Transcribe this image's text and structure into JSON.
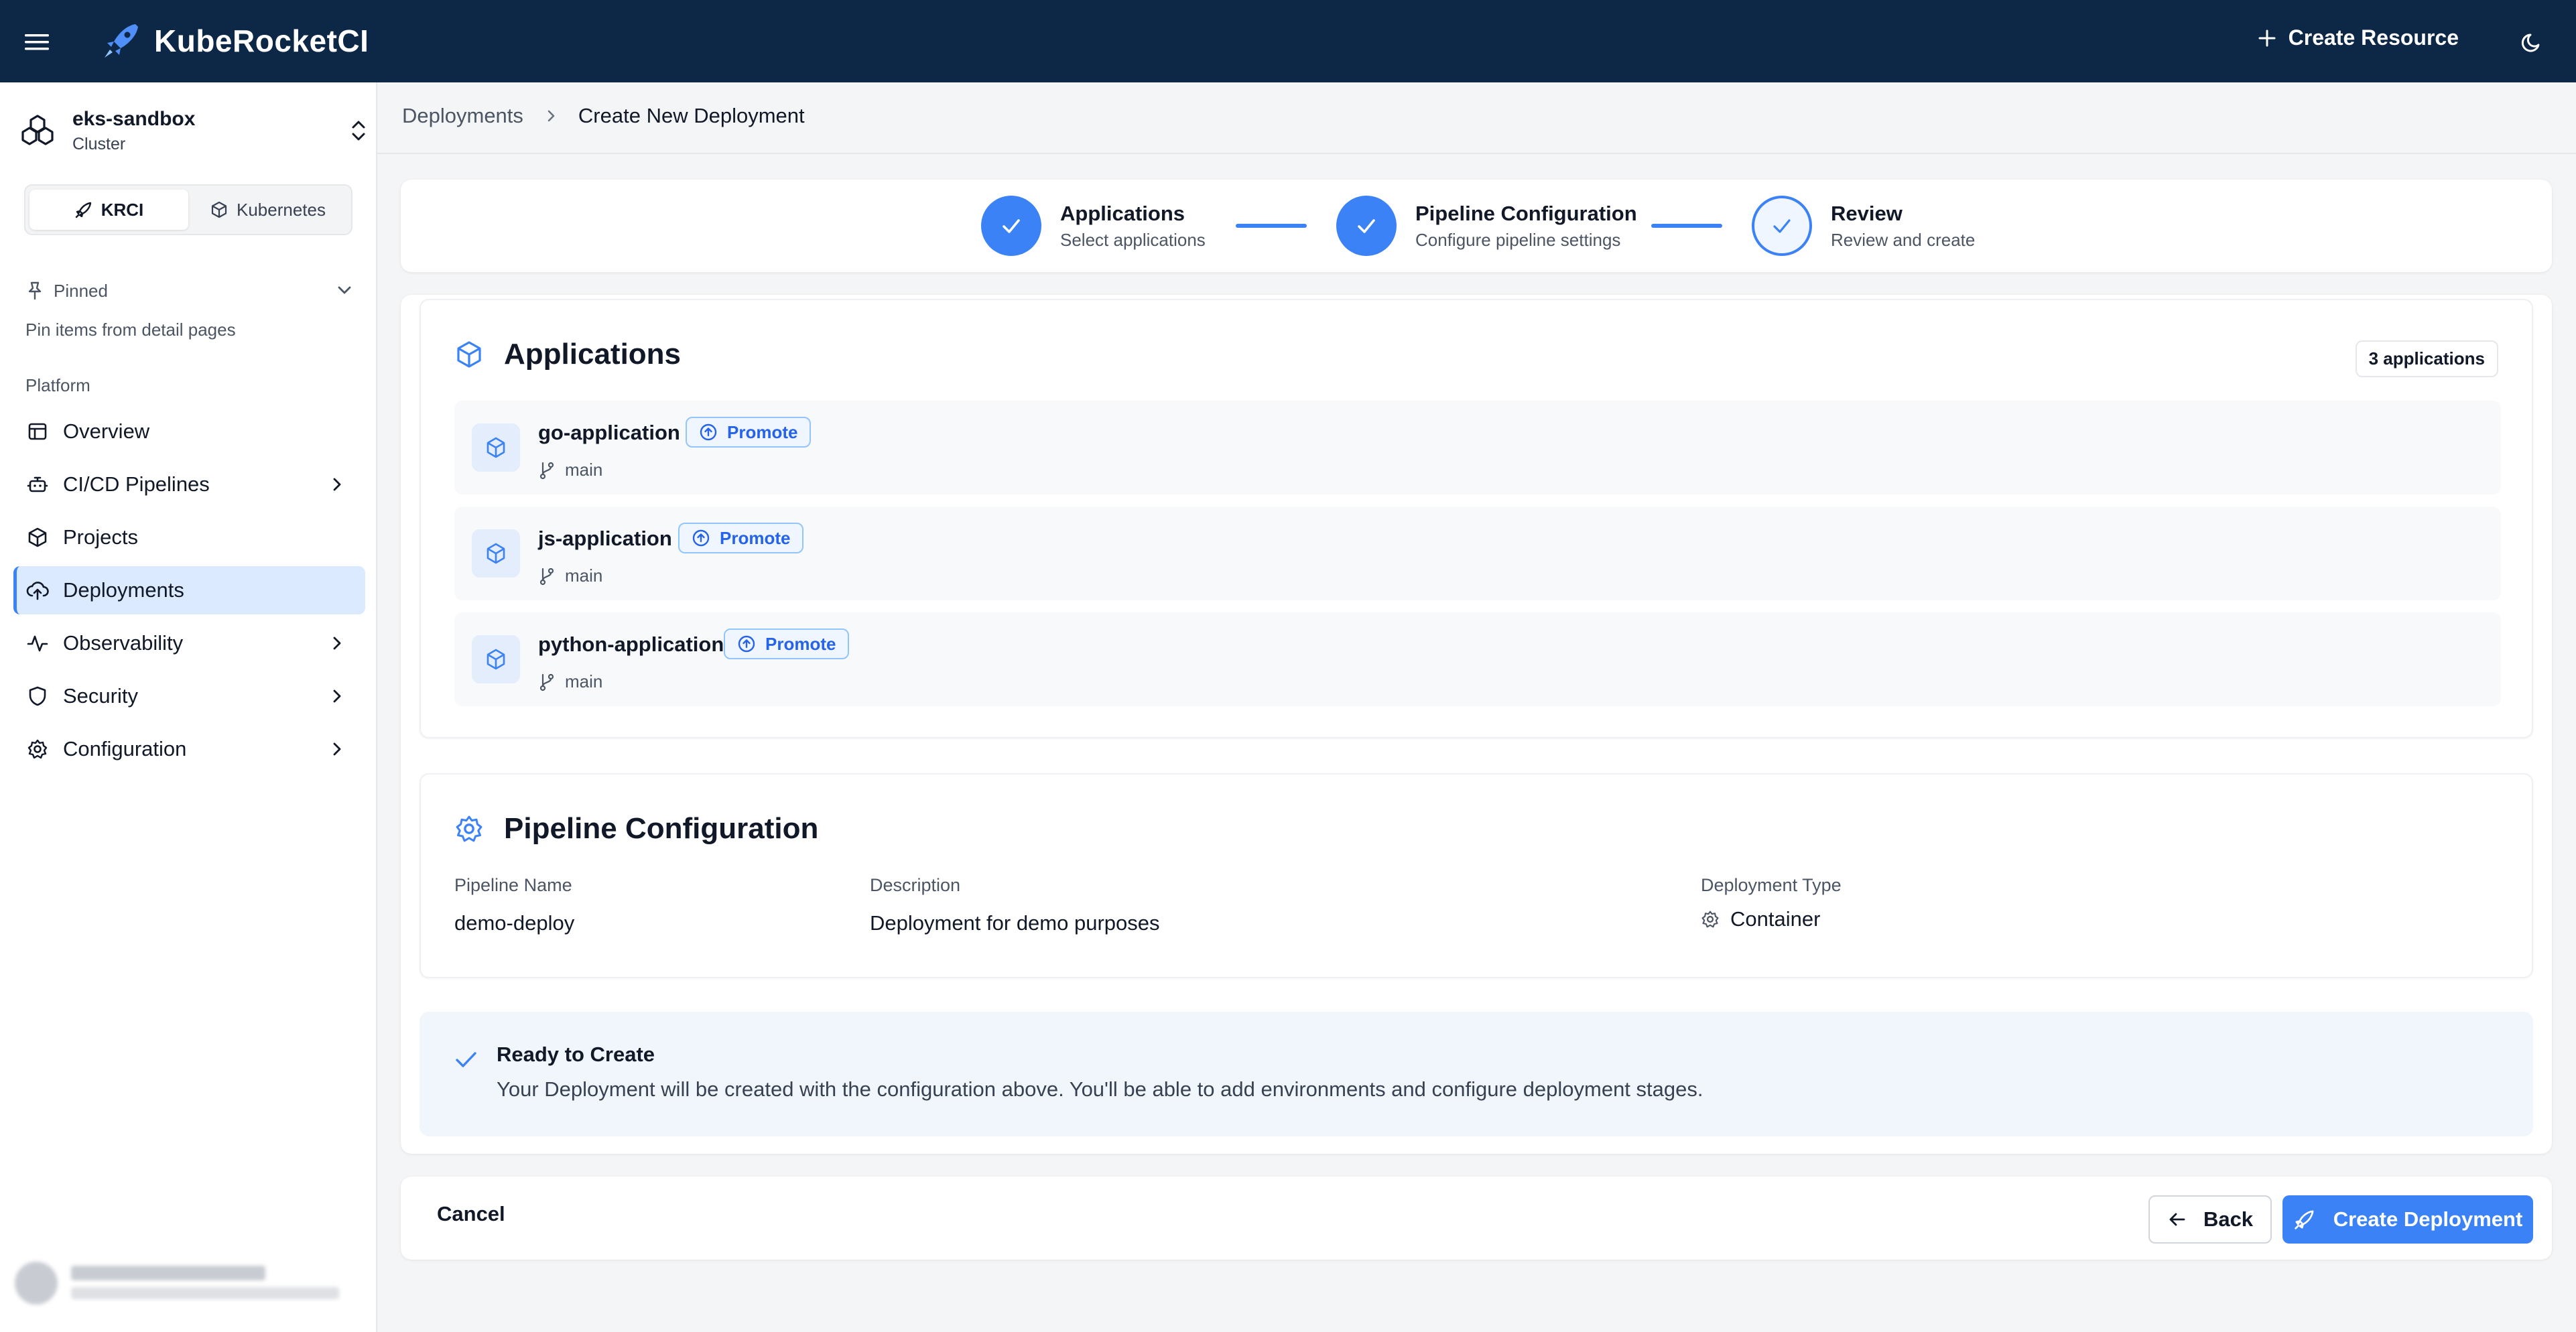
{
  "app": {
    "title": "KubeRocketCI",
    "create_resource_label": "Create Resource"
  },
  "sidebar": {
    "cluster": {
      "name": "eks-sandbox",
      "type": "Cluster"
    },
    "mode_tabs": [
      {
        "label": "KRCI",
        "active": true
      },
      {
        "label": "Kubernetes",
        "active": false
      }
    ],
    "pinned": {
      "label": "Pinned",
      "hint": "Pin items from detail pages"
    },
    "section_label": "Platform",
    "items": [
      {
        "label": "Overview",
        "icon": "table-icon",
        "has_children": false
      },
      {
        "label": "CI/CD Pipelines",
        "icon": "bot-icon",
        "has_children": true
      },
      {
        "label": "Projects",
        "icon": "box-icon",
        "has_children": false
      },
      {
        "label": "Deployments",
        "icon": "cloud-upload-icon",
        "has_children": false,
        "active": true
      },
      {
        "label": "Observability",
        "icon": "activity-icon",
        "has_children": true
      },
      {
        "label": "Security",
        "icon": "shield-icon",
        "has_children": true
      },
      {
        "label": "Configuration",
        "icon": "gear-icon",
        "has_children": true
      }
    ]
  },
  "breadcrumb": {
    "parent": "Deployments",
    "current": "Create New Deployment"
  },
  "stepper": {
    "steps": [
      {
        "title": "Applications",
        "subtitle": "Select applications",
        "status": "done"
      },
      {
        "title": "Pipeline Configuration",
        "subtitle": "Configure pipeline settings",
        "status": "done"
      },
      {
        "title": "Review",
        "subtitle": "Review and create",
        "status": "current"
      }
    ]
  },
  "applications": {
    "title": "Applications",
    "count_label": "3 applications",
    "items": [
      {
        "name": "go-application",
        "badge": "Promote",
        "branch": "main"
      },
      {
        "name": "js-application",
        "badge": "Promote",
        "branch": "main"
      },
      {
        "name": "python-application",
        "badge": "Promote",
        "branch": "main"
      }
    ]
  },
  "pipeline": {
    "title": "Pipeline Configuration",
    "fields": {
      "name": {
        "label": "Pipeline Name",
        "value": "demo-deploy"
      },
      "description": {
        "label": "Description",
        "value": "Deployment for demo purposes"
      },
      "type": {
        "label": "Deployment Type",
        "value": "Container"
      }
    }
  },
  "ready": {
    "title": "Ready to Create",
    "text": "Your Deployment will be created with the configuration above. You'll be able to add environments and configure deployment stages."
  },
  "footer": {
    "cancel_label": "Cancel",
    "back_label": "Back",
    "create_label": "Create Deployment"
  },
  "colors": {
    "topbar": "#0d2747",
    "accent": "#3b82f6",
    "active_nav_bg": "#dbeafe"
  }
}
